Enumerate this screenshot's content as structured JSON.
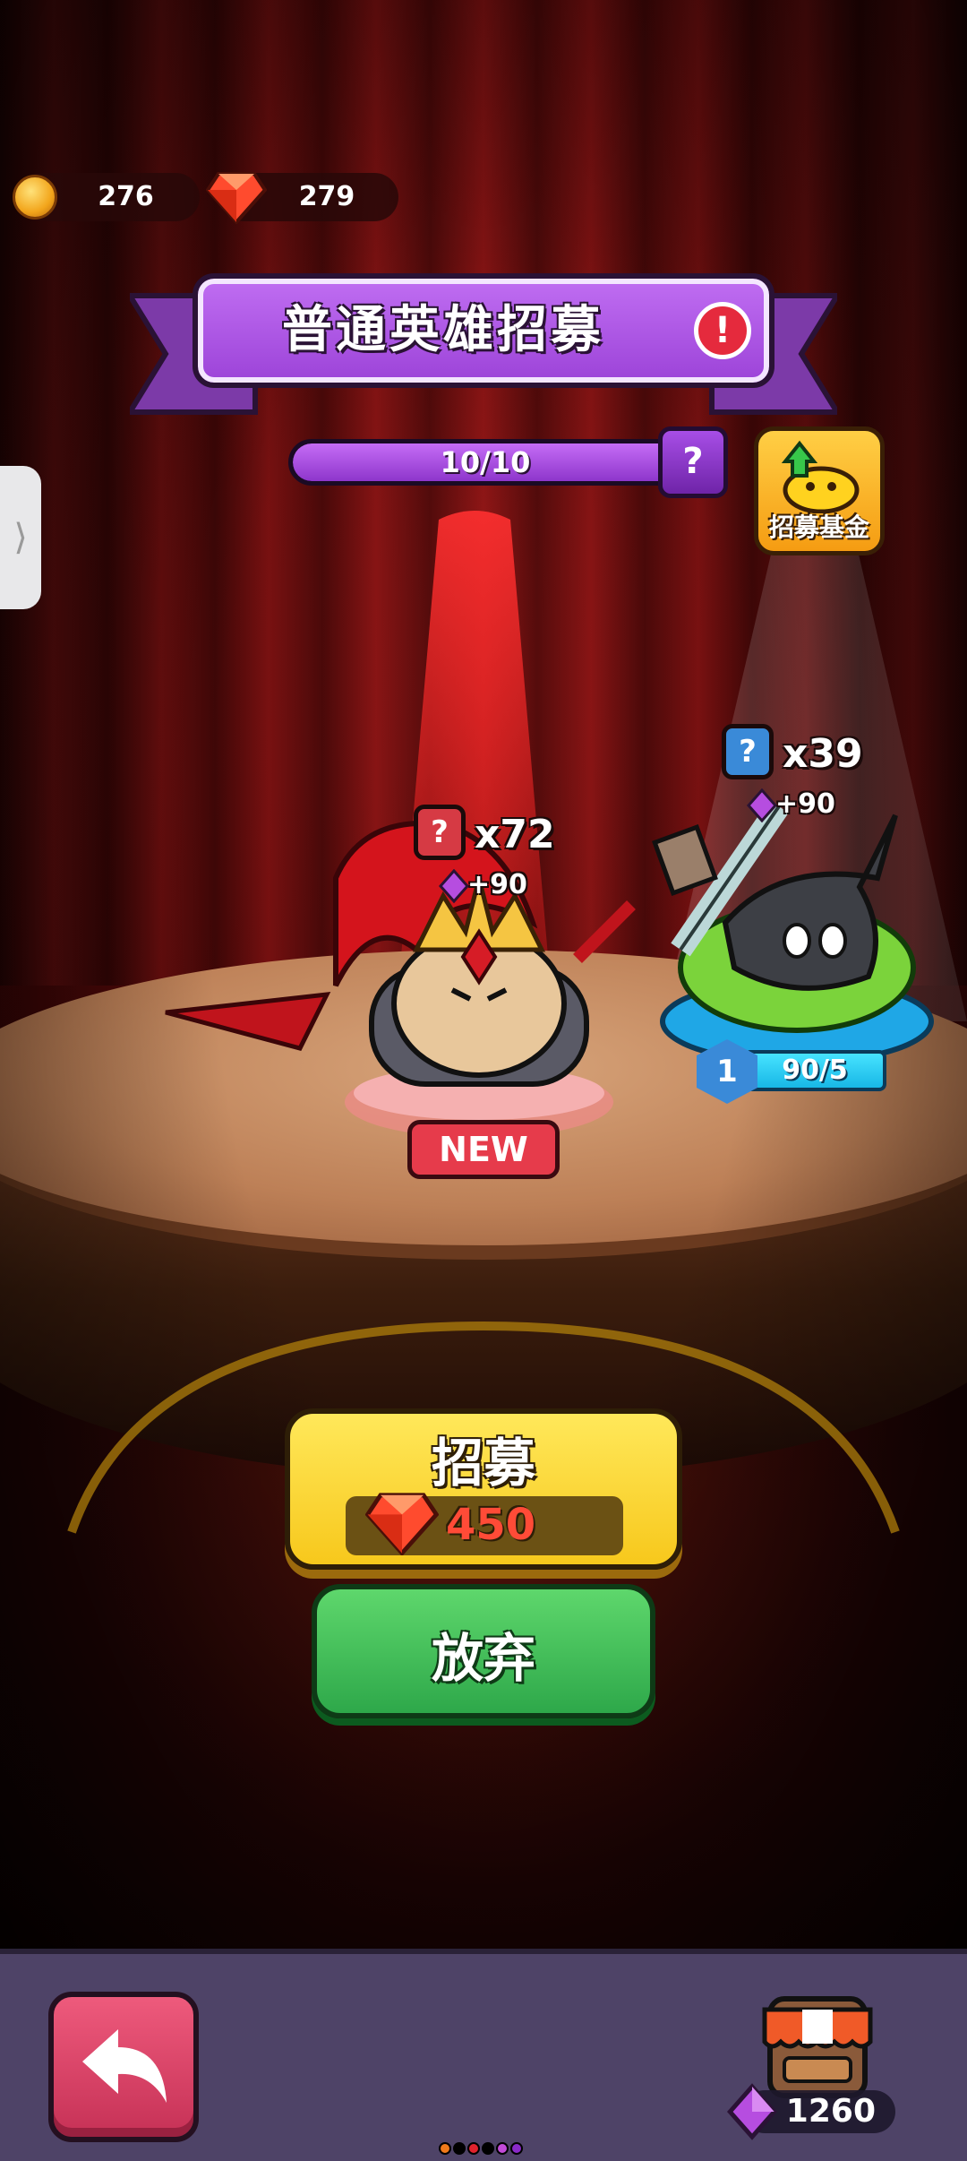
{
  "resources": {
    "gold": {
      "value": "276",
      "icon": "gold-coin-icon"
    },
    "rubies": {
      "value": "279",
      "icon": "ruby-gem-icon"
    }
  },
  "banner": {
    "title": "普通英雄招募",
    "alert_icon": "exclamation-icon"
  },
  "pity_progress": {
    "text": "10/10",
    "current": 10,
    "max": 10,
    "help_icon": "question-icon",
    "help_label": "?"
  },
  "recruit_fund": {
    "label": "招募基金",
    "icon": "upgrade-slime-icon"
  },
  "heroes": [
    {
      "name": "red-plumed-knight",
      "count": "x72",
      "bonus": "+90",
      "badge": "NEW",
      "tag": "?",
      "tag_color": "#d63a44"
    },
    {
      "name": "green-slime-swordsman",
      "count": "x39",
      "bonus": "+90",
      "tag": "?",
      "tag_color": "#3a8ad8",
      "level": "1",
      "progress_text": "90/5"
    }
  ],
  "actions": {
    "recruit": {
      "label": "招募",
      "price": "450",
      "currency_icon": "ruby-gem-icon"
    },
    "abandon": {
      "label": "放弃"
    }
  },
  "side_tab": {
    "icon": "chevron-right-icon",
    "glyph": "⟩"
  },
  "bottom_bar": {
    "back_icon": "back-arrow-icon",
    "shop_icon": "shop-stall-icon",
    "balance": {
      "value": "1260",
      "icon": "purple-gem-icon"
    },
    "page_dots": [
      "#f07a1a",
      "#000000",
      "#e0232d",
      "#000000",
      "#c24ad8",
      "#8a2ac9"
    ]
  },
  "colors": {
    "ruby": "#ff4b37",
    "purple_gem": "#b64de0",
    "accent_purple": "#a74ee6"
  }
}
